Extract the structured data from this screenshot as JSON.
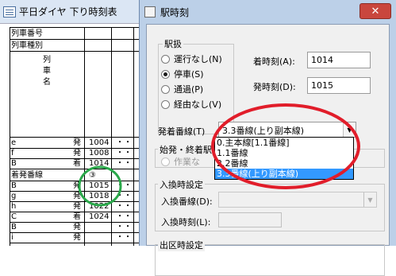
{
  "bg": {
    "title": "平日ダイヤ 下り時刻表",
    "header_rows": [
      "列車番号",
      "列車種別"
    ],
    "vertical_label": [
      "列",
      "車",
      "名"
    ],
    "rows": [
      {
        "sta": "e",
        "kind": "発",
        "time": "1004",
        "dots": "・・"
      },
      {
        "sta": "f",
        "kind": "発",
        "time": "1008",
        "dots": "・・"
      },
      {
        "sta": "B",
        "kind": "着",
        "time": "1014",
        "dots": "・・"
      },
      {
        "sta": "着発番線",
        "kind": "",
        "time": "③",
        "dots": ""
      },
      {
        "sta": "B",
        "kind": "発",
        "time": "1015",
        "dots": "・・"
      },
      {
        "sta": "g",
        "kind": "発",
        "time": "1018",
        "dots": "・・"
      },
      {
        "sta": "h",
        "kind": "発",
        "time": "1022",
        "dots": "・・"
      },
      {
        "sta": "C",
        "kind": "着",
        "time": "1024",
        "dots": "・・"
      },
      {
        "sta": "B",
        "kind": "発",
        "time": "",
        "dots": "・・"
      },
      {
        "sta": "i",
        "kind": "発",
        "time": "",
        "dots": "・・"
      }
    ]
  },
  "dialog": {
    "title": "駅時刻",
    "close": "✕",
    "ekiatsukai": {
      "label": "駅扱",
      "options": [
        "運行なし(N)",
        "停車(S)",
        "通過(P)",
        "経由なし(V)"
      ],
      "selected": 1
    },
    "arrive_label": "着時刻(A):",
    "arrive_value": "1014",
    "depart_label": "発時刻(D):",
    "depart_value": "1015",
    "track_label": "発着番線(T)",
    "track_value": "3.3番線(上り副本線)",
    "dropdown_options": [
      "0.主本線[1.1番線]",
      "1.1番線",
      "2.2番線",
      "3.3番線(上り副本線)"
    ],
    "dropdown_selected": 3,
    "origin_label": "始発・終着駅",
    "work_label": "作業な",
    "transfer_label": "入換時設定",
    "transfer_track_label": "入換番線(D):",
    "transfer_time_label": "入換時刻(L):",
    "depot_label": "出区時設定"
  }
}
